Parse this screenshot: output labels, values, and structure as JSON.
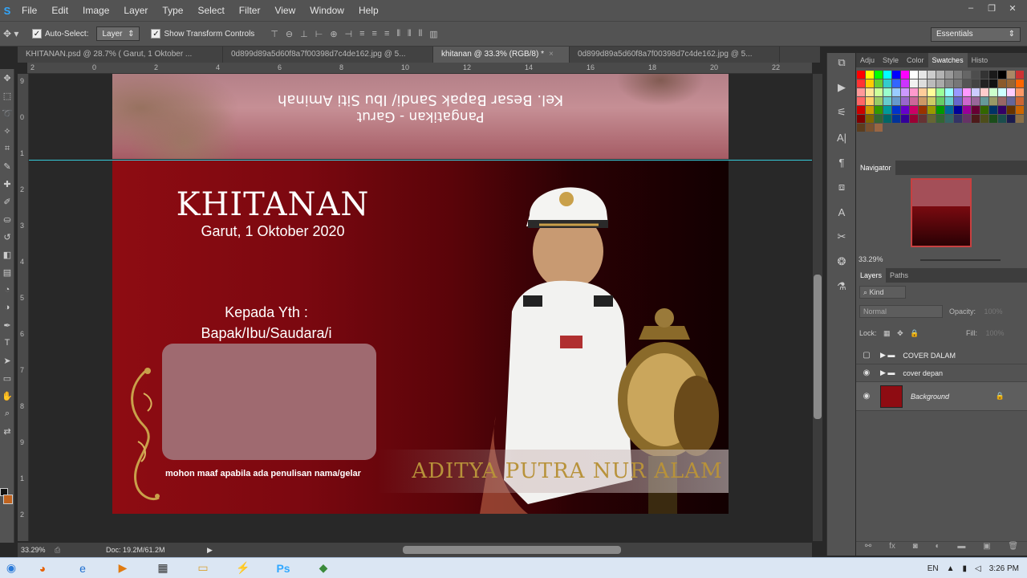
{
  "app": {
    "logo_glyph": "S"
  },
  "menu": [
    "File",
    "Edit",
    "Image",
    "Layer",
    "Type",
    "Select",
    "Filter",
    "View",
    "Window",
    "Help"
  ],
  "window_controls": [
    "–",
    "❐",
    "✕"
  ],
  "options_bar": {
    "auto_select_label": "Auto-Select:",
    "auto_select_value": "Layer",
    "transform_controls_label": "Show Transform Controls",
    "workspace": "Essentials"
  },
  "tabs": [
    {
      "label": "KHITANAN.psd @ 28.7% (  Garut, 1 Oktober ...",
      "active": false
    },
    {
      "label": "0d899d89a5d60f8a7f00398d7c4de162.jpg @ 5...",
      "active": false
    },
    {
      "label": "khitanan @ 33.3% (RGB/8) *",
      "active": true
    },
    {
      "label": "0d899d89a5d60f8a7f00398d7c4de162.jpg @ 5...",
      "active": false
    }
  ],
  "ruler_h": [
    "2",
    "0",
    "2",
    "4",
    "6",
    "8",
    "10",
    "12",
    "14",
    "16",
    "18",
    "20",
    "22"
  ],
  "ruler_v": [
    "9",
    "0",
    "1",
    "2",
    "3",
    "4",
    "5",
    "6",
    "7",
    "8",
    "9",
    "1",
    "2"
  ],
  "document": {
    "back_line1": "Kel. Besar Bapak Sandi/ Ibu Siti Aminah",
    "back_line2": "Pangatikan - Garut",
    "title": "KHITANAN",
    "date": "Garut, 1 Oktober 2020",
    "kepada_line1": "Kepada Yth :",
    "kepada_line2": "Bapak/Ibu/Saudara/i",
    "note": "mohon maaf apabila ada penulisan nama/gelar",
    "child_name": "ADITYA PUTRA NUR ALAM",
    "background_color": "#8e0c12",
    "box_color": "#9f6a70"
  },
  "status": {
    "zoom": "33.29%",
    "doc_size": "Doc: 19.2M/61.2M"
  },
  "panels": {
    "top_tabs": [
      "Adju",
      "Style",
      "Color",
      "Swatches",
      "Histo"
    ],
    "active_top_tab": "Swatches",
    "navigator_title": "Navigator",
    "navigator_zoom": "33.29%",
    "layers_tabs": [
      "Layers",
      "Paths"
    ],
    "kind_label": "Kind",
    "blend_mode": "Normal",
    "opacity_label": "Opacity:",
    "opacity_value": "100%",
    "lock_label": "Lock:",
    "fill_label": "Fill:",
    "fill_value": "100%",
    "layers": [
      {
        "name": "COVER DALAM",
        "visible": false,
        "type": "group"
      },
      {
        "name": "cover depan",
        "visible": true,
        "type": "group"
      },
      {
        "name": "Background",
        "visible": true,
        "type": "background",
        "color": "#8e0c12"
      }
    ]
  },
  "swatches": [
    "#ff0000",
    "#ffff00",
    "#00ff00",
    "#00ffff",
    "#0000ff",
    "#ff00ff",
    "#ffffff",
    "#e6e6e6",
    "#cccccc",
    "#b3b3b3",
    "#999999",
    "#808080",
    "#666666",
    "#4d4d4d",
    "#333333",
    "#1a1a1a",
    "#000000",
    "#aa8866",
    "#cc3333",
    "#ff3333",
    "#ffcc00",
    "#66cc33",
    "#33cccc",
    "#3366ff",
    "#cc33ff",
    "#f2f2f2",
    "#dddddd",
    "#bbbbbb",
    "#aaaaaa",
    "#888888",
    "#777777",
    "#555555",
    "#444444",
    "#222222",
    "#111111",
    "#8b5a2b",
    "#996633",
    "#ff6600",
    "#ff9999",
    "#ffe699",
    "#ccff99",
    "#99ffcc",
    "#99ccff",
    "#cc99ff",
    "#ff99cc",
    "#ffcc99",
    "#ffff99",
    "#99ff99",
    "#99ffff",
    "#9999ff",
    "#ff99ff",
    "#ccccff",
    "#ffcccc",
    "#ccffcc",
    "#ccffff",
    "#ffccff",
    "#ff9966",
    "#ff6666",
    "#ffcc66",
    "#99cc66",
    "#66cccc",
    "#6699cc",
    "#9966cc",
    "#cc6699",
    "#cc9966",
    "#cccc66",
    "#66cc66",
    "#66cccc",
    "#6666cc",
    "#cc66cc",
    "#996699",
    "#669999",
    "#999966",
    "#996666",
    "#666699",
    "#cc6633",
    "#cc0000",
    "#cc9900",
    "#339900",
    "#009999",
    "#0033cc",
    "#6600cc",
    "#cc0066",
    "#993300",
    "#999900",
    "#009900",
    "#006699",
    "#000099",
    "#990099",
    "#660033",
    "#336600",
    "#003366",
    "#330066",
    "#663300",
    "#cc6600",
    "#800000",
    "#806600",
    "#336633",
    "#006666",
    "#003399",
    "#330099",
    "#990033",
    "#663333",
    "#666633",
    "#336633",
    "#336666",
    "#333366",
    "#663366",
    "#4d1a1a",
    "#4d4d1a",
    "#1a4d1a",
    "#1a4d4d",
    "#1a1a4d",
    "#8b6f47",
    "#5c3d1e",
    "#7a5230",
    "#996644"
  ],
  "taskbar": {
    "icons": [
      "start-orb",
      "firefox",
      "ie",
      "media",
      "calendar",
      "explorer",
      "winamp",
      "photoshop",
      "green-app"
    ],
    "lang": "EN",
    "time": "3:26 PM"
  }
}
